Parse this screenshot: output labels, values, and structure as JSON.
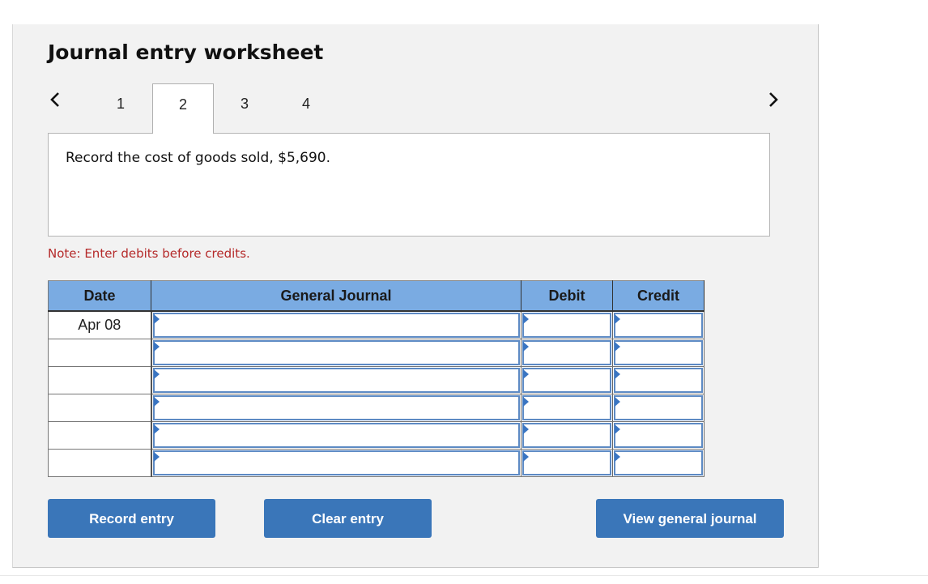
{
  "worksheet": {
    "title": "Journal entry worksheet",
    "nav": {
      "prev_icon": "chevron-left-icon",
      "next_icon": "chevron-right-icon",
      "tabs": [
        {
          "label": "1",
          "active": false
        },
        {
          "label": "2",
          "active": true
        },
        {
          "label": "3",
          "active": false
        },
        {
          "label": "4",
          "active": false
        }
      ]
    },
    "prompt": "Record the cost of goods sold, $5,690.",
    "note": "Note: Enter debits before credits.",
    "table": {
      "headers": {
        "date": "Date",
        "general_journal": "General Journal",
        "debit": "Debit",
        "credit": "Credit"
      },
      "rows": [
        {
          "date": "Apr 08",
          "account": "",
          "debit": "",
          "credit": ""
        },
        {
          "date": "",
          "account": "",
          "debit": "",
          "credit": ""
        },
        {
          "date": "",
          "account": "",
          "debit": "",
          "credit": ""
        },
        {
          "date": "",
          "account": "",
          "debit": "",
          "credit": ""
        },
        {
          "date": "",
          "account": "",
          "debit": "",
          "credit": ""
        },
        {
          "date": "",
          "account": "",
          "debit": "",
          "credit": ""
        }
      ]
    },
    "buttons": {
      "record": "Record entry",
      "clear": "Clear entry",
      "view": "View general journal"
    }
  },
  "colors": {
    "header_blue": "#7aabe2",
    "button_blue": "#3a76b9",
    "note_red": "#b52a2a",
    "input_border": "#5d8ac4"
  }
}
